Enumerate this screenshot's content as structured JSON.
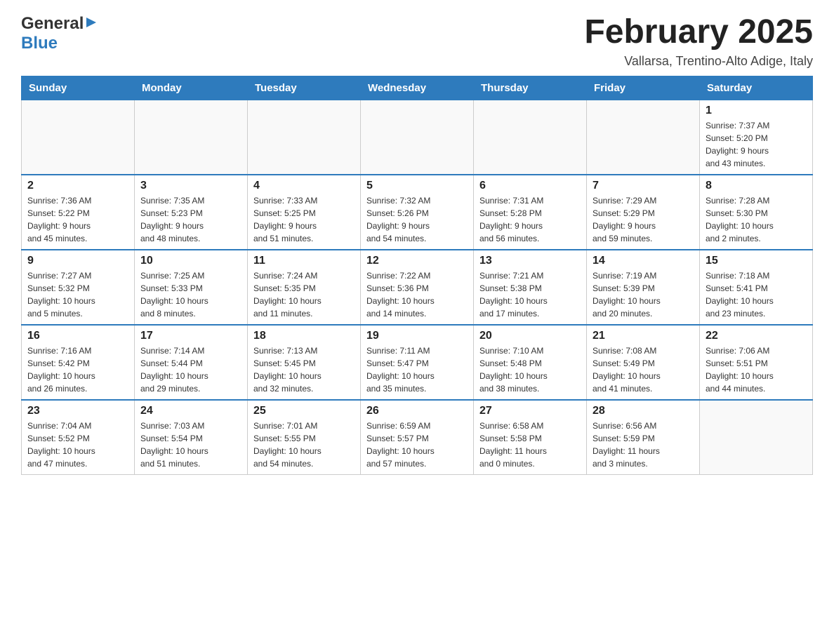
{
  "header": {
    "logo_general": "General",
    "logo_blue": "Blue",
    "month_title": "February 2025",
    "location": "Vallarsa, Trentino-Alto Adige, Italy"
  },
  "days_of_week": [
    "Sunday",
    "Monday",
    "Tuesday",
    "Wednesday",
    "Thursday",
    "Friday",
    "Saturday"
  ],
  "weeks": [
    [
      {
        "day": "",
        "info": ""
      },
      {
        "day": "",
        "info": ""
      },
      {
        "day": "",
        "info": ""
      },
      {
        "day": "",
        "info": ""
      },
      {
        "day": "",
        "info": ""
      },
      {
        "day": "",
        "info": ""
      },
      {
        "day": "1",
        "info": "Sunrise: 7:37 AM\nSunset: 5:20 PM\nDaylight: 9 hours\nand 43 minutes."
      }
    ],
    [
      {
        "day": "2",
        "info": "Sunrise: 7:36 AM\nSunset: 5:22 PM\nDaylight: 9 hours\nand 45 minutes."
      },
      {
        "day": "3",
        "info": "Sunrise: 7:35 AM\nSunset: 5:23 PM\nDaylight: 9 hours\nand 48 minutes."
      },
      {
        "day": "4",
        "info": "Sunrise: 7:33 AM\nSunset: 5:25 PM\nDaylight: 9 hours\nand 51 minutes."
      },
      {
        "day": "5",
        "info": "Sunrise: 7:32 AM\nSunset: 5:26 PM\nDaylight: 9 hours\nand 54 minutes."
      },
      {
        "day": "6",
        "info": "Sunrise: 7:31 AM\nSunset: 5:28 PM\nDaylight: 9 hours\nand 56 minutes."
      },
      {
        "day": "7",
        "info": "Sunrise: 7:29 AM\nSunset: 5:29 PM\nDaylight: 9 hours\nand 59 minutes."
      },
      {
        "day": "8",
        "info": "Sunrise: 7:28 AM\nSunset: 5:30 PM\nDaylight: 10 hours\nand 2 minutes."
      }
    ],
    [
      {
        "day": "9",
        "info": "Sunrise: 7:27 AM\nSunset: 5:32 PM\nDaylight: 10 hours\nand 5 minutes."
      },
      {
        "day": "10",
        "info": "Sunrise: 7:25 AM\nSunset: 5:33 PM\nDaylight: 10 hours\nand 8 minutes."
      },
      {
        "day": "11",
        "info": "Sunrise: 7:24 AM\nSunset: 5:35 PM\nDaylight: 10 hours\nand 11 minutes."
      },
      {
        "day": "12",
        "info": "Sunrise: 7:22 AM\nSunset: 5:36 PM\nDaylight: 10 hours\nand 14 minutes."
      },
      {
        "day": "13",
        "info": "Sunrise: 7:21 AM\nSunset: 5:38 PM\nDaylight: 10 hours\nand 17 minutes."
      },
      {
        "day": "14",
        "info": "Sunrise: 7:19 AM\nSunset: 5:39 PM\nDaylight: 10 hours\nand 20 minutes."
      },
      {
        "day": "15",
        "info": "Sunrise: 7:18 AM\nSunset: 5:41 PM\nDaylight: 10 hours\nand 23 minutes."
      }
    ],
    [
      {
        "day": "16",
        "info": "Sunrise: 7:16 AM\nSunset: 5:42 PM\nDaylight: 10 hours\nand 26 minutes."
      },
      {
        "day": "17",
        "info": "Sunrise: 7:14 AM\nSunset: 5:44 PM\nDaylight: 10 hours\nand 29 minutes."
      },
      {
        "day": "18",
        "info": "Sunrise: 7:13 AM\nSunset: 5:45 PM\nDaylight: 10 hours\nand 32 minutes."
      },
      {
        "day": "19",
        "info": "Sunrise: 7:11 AM\nSunset: 5:47 PM\nDaylight: 10 hours\nand 35 minutes."
      },
      {
        "day": "20",
        "info": "Sunrise: 7:10 AM\nSunset: 5:48 PM\nDaylight: 10 hours\nand 38 minutes."
      },
      {
        "day": "21",
        "info": "Sunrise: 7:08 AM\nSunset: 5:49 PM\nDaylight: 10 hours\nand 41 minutes."
      },
      {
        "day": "22",
        "info": "Sunrise: 7:06 AM\nSunset: 5:51 PM\nDaylight: 10 hours\nand 44 minutes."
      }
    ],
    [
      {
        "day": "23",
        "info": "Sunrise: 7:04 AM\nSunset: 5:52 PM\nDaylight: 10 hours\nand 47 minutes."
      },
      {
        "day": "24",
        "info": "Sunrise: 7:03 AM\nSunset: 5:54 PM\nDaylight: 10 hours\nand 51 minutes."
      },
      {
        "day": "25",
        "info": "Sunrise: 7:01 AM\nSunset: 5:55 PM\nDaylight: 10 hours\nand 54 minutes."
      },
      {
        "day": "26",
        "info": "Sunrise: 6:59 AM\nSunset: 5:57 PM\nDaylight: 10 hours\nand 57 minutes."
      },
      {
        "day": "27",
        "info": "Sunrise: 6:58 AM\nSunset: 5:58 PM\nDaylight: 11 hours\nand 0 minutes."
      },
      {
        "day": "28",
        "info": "Sunrise: 6:56 AM\nSunset: 5:59 PM\nDaylight: 11 hours\nand 3 minutes."
      },
      {
        "day": "",
        "info": ""
      }
    ]
  ]
}
